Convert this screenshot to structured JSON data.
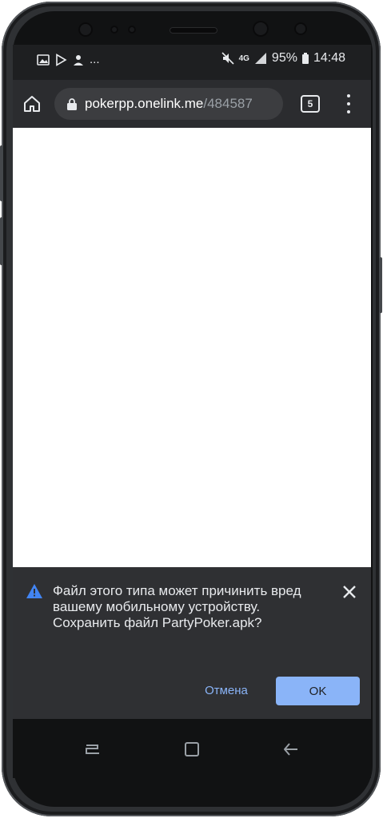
{
  "status_bar": {
    "icons_left": [
      "image-icon",
      "play-store-icon",
      "missed-call-icon"
    ],
    "more": "...",
    "network": "4G",
    "battery": "95%",
    "time": "14:48"
  },
  "browser": {
    "url_domain": "pokerpp.onelink.me",
    "url_path": "/484587",
    "tab_count": "5"
  },
  "download_dialog": {
    "message": "Файл этого типа может причинить вред вашему мобильному устройству. Сохранить файл PartyPoker.apk?",
    "cancel_label": "Отмена",
    "ok_label": "OK"
  },
  "colors": {
    "accent": "#8ab4f8",
    "warning": "#4285f4",
    "toolbar": "#2b2c2f",
    "dialog": "#2f3033"
  }
}
